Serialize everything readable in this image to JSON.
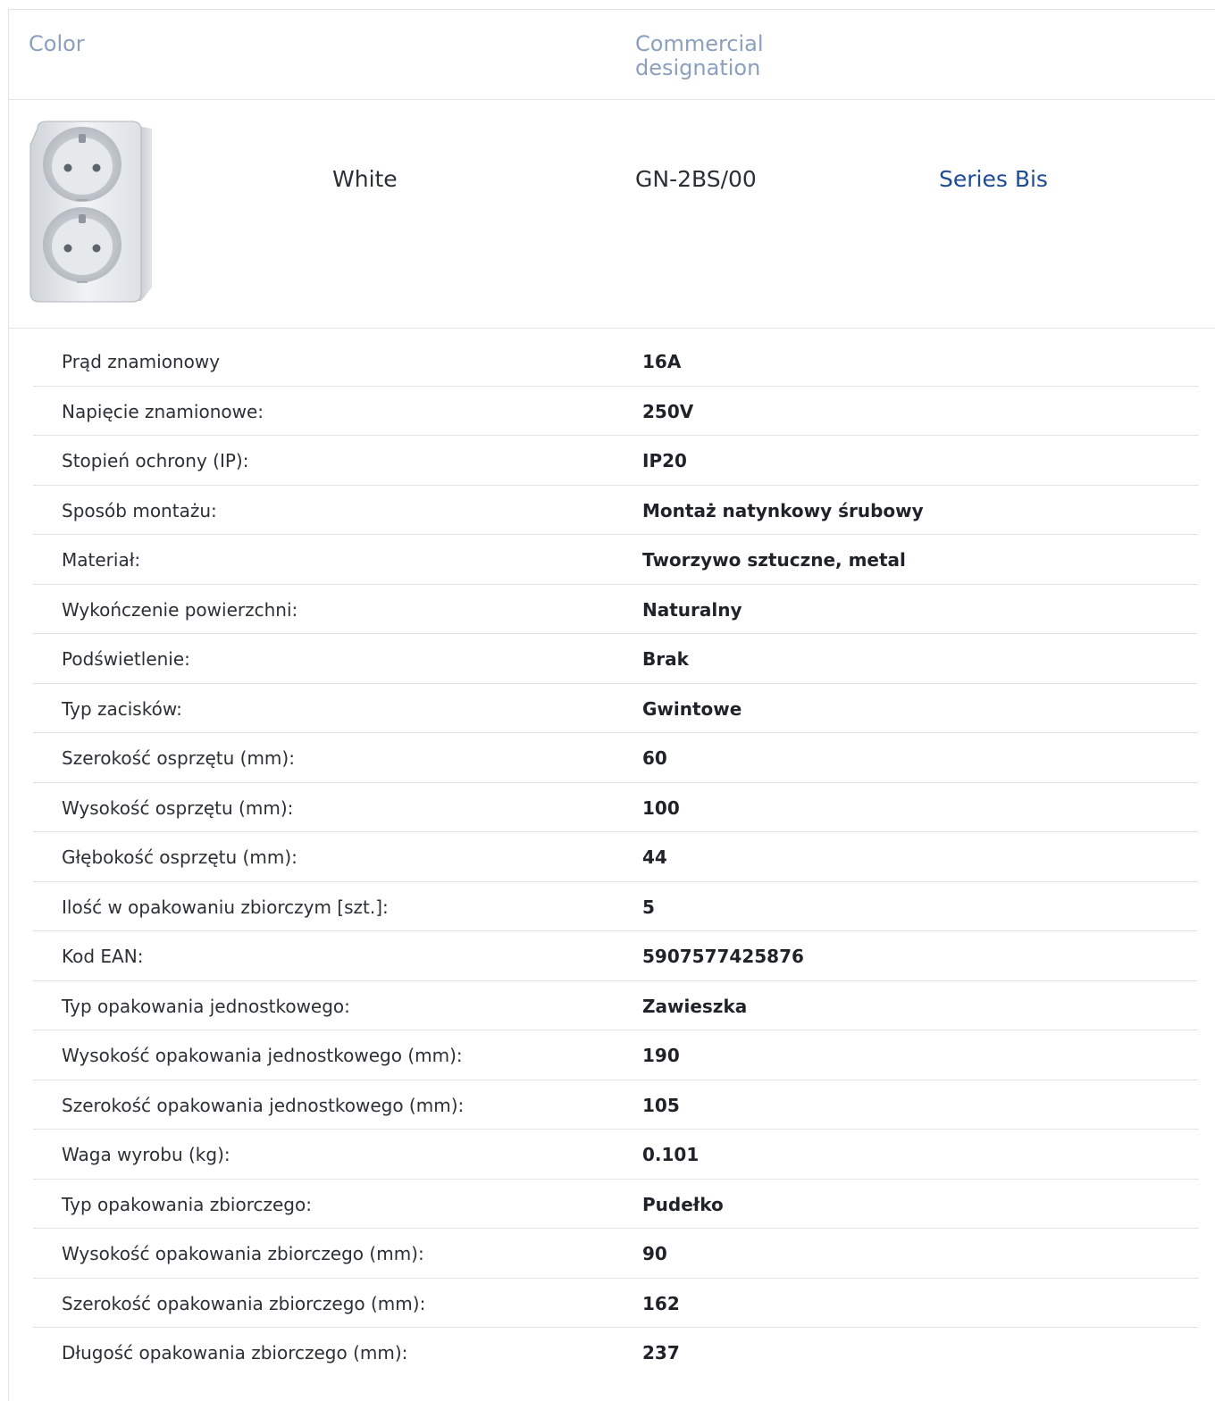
{
  "header": {
    "color_label": "Color",
    "commercial_label": "Commercial designation"
  },
  "product": {
    "image_icon": "double-socket-outlet",
    "color": "White",
    "code": "GN-2BS/00",
    "series": "Series Bis"
  },
  "specs": [
    {
      "label": "Prąd znamionowy",
      "value": "16A"
    },
    {
      "label": "Napięcie znamionowe:",
      "value": "250V"
    },
    {
      "label": "Stopień ochrony (IP):",
      "value": "IP20"
    },
    {
      "label": "Sposób montażu:",
      "value": "Montaż natynkowy śrubowy"
    },
    {
      "label": "Materiał:",
      "value": "Tworzywo sztuczne, metal"
    },
    {
      "label": "Wykończenie powierzchni:",
      "value": "Naturalny"
    },
    {
      "label": "Podświetlenie:",
      "value": "Brak"
    },
    {
      "label": "Typ zacisków:",
      "value": "Gwintowe"
    },
    {
      "label": "Szerokość osprzętu (mm):",
      "value": "60"
    },
    {
      "label": "Wysokość osprzętu (mm):",
      "value": "100"
    },
    {
      "label": "Głębokość osprzętu (mm):",
      "value": "44"
    },
    {
      "label": "Ilość w opakowaniu zbiorczym [szt.]:",
      "value": "5"
    },
    {
      "label": "Kod EAN:",
      "value": "5907577425876"
    },
    {
      "label": "Typ opakowania jednostkowego:",
      "value": "Zawieszka"
    },
    {
      "label": "Wysokość opakowania jednostkowego (mm):",
      "value": "190"
    },
    {
      "label": "Szerokość opakowania jednostkowego (mm):",
      "value": "105"
    },
    {
      "label": "Waga wyrobu (kg):",
      "value": "0.101"
    },
    {
      "label": "Typ opakowania zbiorczego:",
      "value": "Pudełko"
    },
    {
      "label": "Wysokość opakowania zbiorczego (mm):",
      "value": "90"
    },
    {
      "label": "Szerokość opakowania zbiorczego (mm):",
      "value": "162"
    },
    {
      "label": "Długość opakowania zbiorczego (mm):",
      "value": "237"
    }
  ],
  "colors": {
    "header_text": "#8aa0be",
    "link": "#1f4a96",
    "divider": "#dfe3e8"
  }
}
